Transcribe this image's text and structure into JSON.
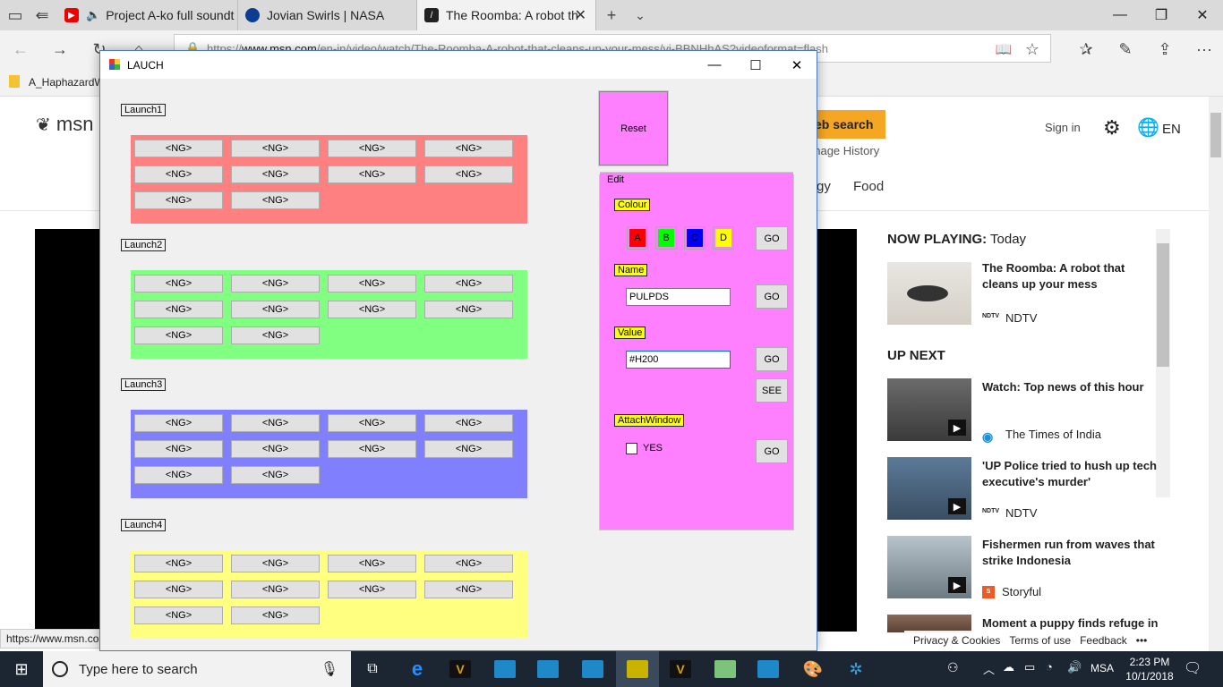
{
  "browser": {
    "tabs": [
      {
        "title": "",
        "icon": "tab-manager-icon"
      },
      {
        "title": "Project A-ko full soundt",
        "icon": "youtube-icon"
      },
      {
        "title": "Jovian Swirls | NASA",
        "icon": "nasa-icon"
      },
      {
        "title": "The Roomba: A robot th",
        "icon": "msn-icon"
      }
    ],
    "url_prefix": "https://",
    "url_domain": "www.msn.com",
    "url_rest": "/en-in/video/watch/The-Roomba-A-robot-that-cleans-up-your-mess/vi-BBNHhAS?videoformat=flash",
    "favorite": "A_HaphazardW"
  },
  "msn": {
    "logo": "msn",
    "search_button": "eb search",
    "manage_history": "anage History",
    "sign_in": "Sign in",
    "language": "EN",
    "nav": [
      "gy",
      "Food"
    ],
    "now_playing_label": "NOW PLAYING:",
    "now_playing_when": "Today",
    "up_next_label": "UP NEXT",
    "items": [
      {
        "title": "The Roomba: A robot that cleans up your mess",
        "source": "NDTV",
        "logo": "NDTV"
      },
      {
        "title": "Watch: Top news of this hour",
        "source": "The Times of India",
        "logo": ""
      },
      {
        "title": "'UP Police tried to hush up tech executive's murder'",
        "source": "NDTV",
        "logo": "NDTV"
      },
      {
        "title": "Fishermen run from waves that strike Indonesia",
        "source": "Storyful",
        "logo": "S"
      },
      {
        "title": "Moment a puppy finds refuge in",
        "source": "",
        "logo": ""
      }
    ],
    "footer": [
      "Privacy & Cookies",
      "Terms of use",
      "Feedback",
      "•••"
    ]
  },
  "status_url": "https://www.msn.co",
  "app": {
    "title": "LAUCH",
    "groups": [
      {
        "label": "Launch1",
        "color": "#ff8080"
      },
      {
        "label": "Launch2",
        "color": "#80ff80"
      },
      {
        "label": "Launch3",
        "color": "#8080ff"
      },
      {
        "label": "Launch4",
        "color": "#ffff80"
      }
    ],
    "ng_label": "<NG>",
    "reset": "Reset",
    "edit": {
      "label": "Edit",
      "colour_label": "Colour",
      "colours": [
        {
          "letter": "A",
          "color": "#ff0000"
        },
        {
          "letter": "B",
          "color": "#00ff00"
        },
        {
          "letter": "C",
          "color": "#0000ff"
        },
        {
          "letter": "D",
          "color": "#ffff00"
        }
      ],
      "name_label": "Name",
      "name_value": "PULPDS",
      "value_label": "Value",
      "value_value": "#H200",
      "attach_label": "AttachWindow",
      "yes_label": "YES",
      "go": "GO",
      "see": "SEE"
    }
  },
  "taskbar": {
    "search_placeholder": "Type here to search",
    "lang": "MSA",
    "time": "2:23 PM",
    "date": "10/1/2018"
  }
}
